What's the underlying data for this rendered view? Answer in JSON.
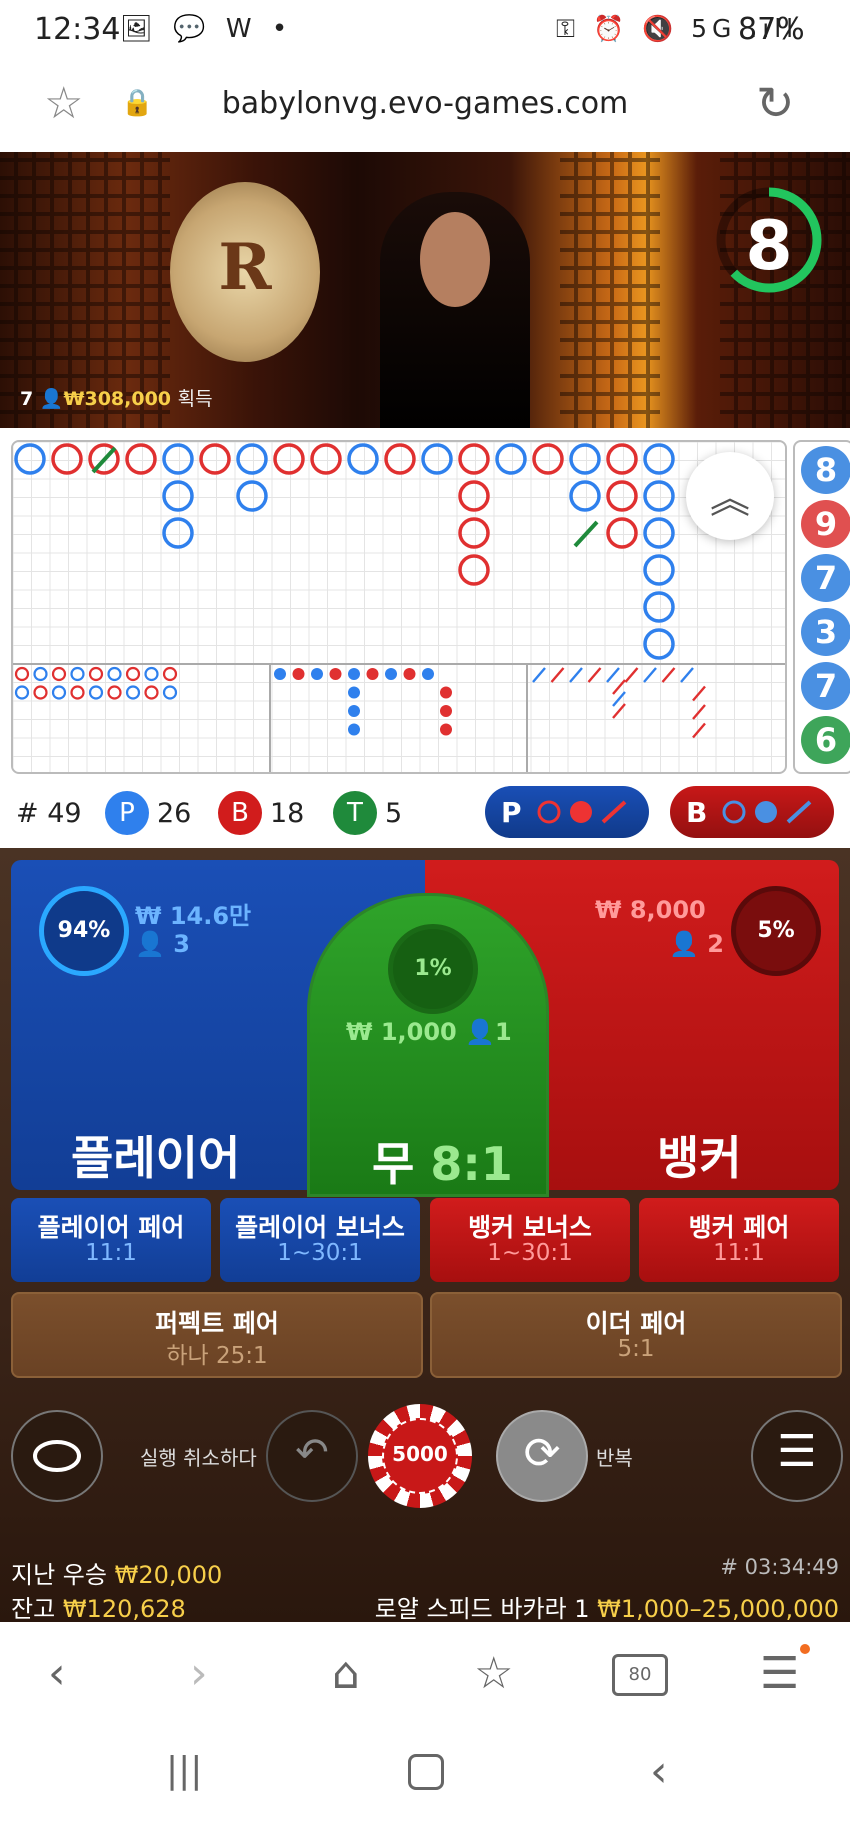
{
  "status_bar": {
    "time": "12:34",
    "left_icons": "🖼 💬 W •",
    "right_icons": "⚿ ⏰ 🔇 5G .ıll",
    "battery": "87%"
  },
  "url_bar": {
    "url": "babylonvg.evo-games.com"
  },
  "video": {
    "bet_count": "7",
    "bet_amount": "₩308,000",
    "bet_label": "획득",
    "timer": "8"
  },
  "roadmap": {
    "side_results": [
      {
        "value": "8",
        "color": "#4a90e2"
      },
      {
        "value": "9",
        "color": "#e05050"
      },
      {
        "value": "7",
        "color": "#4a90e2"
      },
      {
        "value": "3",
        "color": "#4a90e2"
      },
      {
        "value": "7",
        "color": "#4a90e2"
      },
      {
        "value": "6",
        "color": "#3ea55a"
      }
    ]
  },
  "stats": {
    "round": "# 49",
    "player_label": "P",
    "player_count": "26",
    "banker_label": "B",
    "banker_count": "18",
    "tie_label": "T",
    "tie_count": "5",
    "player_predict": "P",
    "banker_predict": "B"
  },
  "betting": {
    "player": {
      "pct": "94%",
      "amount": "₩ 14.6만",
      "users": "3",
      "label": "플레이어"
    },
    "tie": {
      "pct": "1%",
      "amount": "₩ 1,000",
      "users": "1",
      "label": "무",
      "odds": "8:1"
    },
    "banker": {
      "pct": "5%",
      "amount": "₩ 8,000",
      "users": "2",
      "label": "뱅커"
    },
    "side_bets": [
      {
        "title": "플레이어 페어",
        "odds": "11:1"
      },
      {
        "title": "플레이어 보너스",
        "odds": "1~30:1"
      },
      {
        "title": "뱅커 보너스",
        "odds": "1~30:1"
      },
      {
        "title": "뱅커 페어",
        "odds": "11:1"
      }
    ],
    "pair_bets": [
      {
        "title": "퍼펙트 페어",
        "odds": "하나 25:1"
      },
      {
        "title": "이더 페어",
        "odds": "5:1"
      }
    ]
  },
  "controls": {
    "undo_label": "실행 취소하다",
    "chip_value": "5000",
    "repeat_label": "반복"
  },
  "footer": {
    "last_win_label": "지난 우승",
    "last_win": "₩20,000",
    "balance_label": "잔고",
    "balance": "₩120,628",
    "game_id": "# 03:34:49",
    "table_name": "로얄 스피드 바카라 1",
    "limits": "₩1,000–25,000,000"
  },
  "colors": {
    "player": "#1a4fb6",
    "banker": "#d11c1c",
    "tie": "#2fa42a",
    "gold": "#f7cf4a"
  }
}
